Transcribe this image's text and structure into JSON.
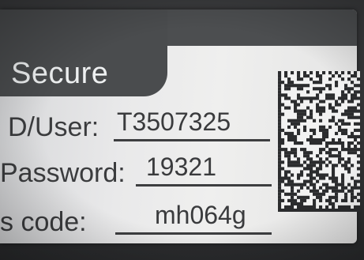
{
  "label": {
    "brand": "Secure",
    "fields": [
      {
        "label": "D/User:",
        "value": "T3507325"
      },
      {
        "label": "Password:",
        "value": "19321"
      },
      {
        "label": "s code:",
        "value": "mh064g"
      }
    ]
  },
  "colors": {
    "plate": "#e9e9ea",
    "header": "#4a4c4e",
    "text": "#3b3c3e"
  },
  "icons": [
    "data-matrix-code"
  ]
}
